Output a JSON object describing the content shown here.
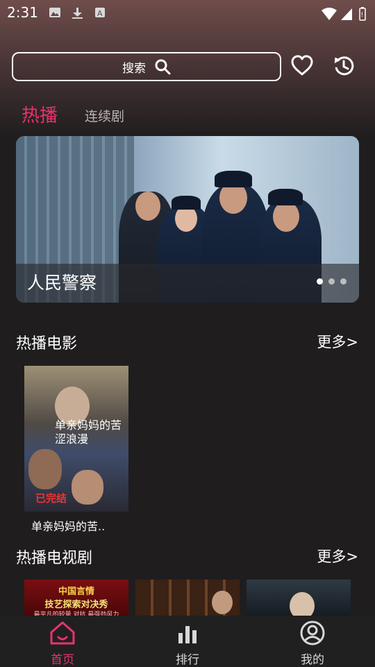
{
  "status_bar": {
    "time": "2:31"
  },
  "search": {
    "label": "搜索"
  },
  "tabs": [
    {
      "label": "热播",
      "active": true
    },
    {
      "label": "连续剧",
      "active": false
    }
  ],
  "banner": {
    "title": "人民警察",
    "dot_count": 3,
    "active_dot": 1
  },
  "movies_section": {
    "title": "热播电影",
    "more": "更多>",
    "items": [
      {
        "caption": "单亲妈妈的苦..",
        "poster_title": "单亲妈妈的苦涩浪漫",
        "poster_badge": "已完结"
      }
    ]
  },
  "tv_section": {
    "title": "热播电视剧",
    "more": "更多>",
    "thumbs": [
      {
        "line1": "中国言情",
        "line2": "技艺探索对决秀",
        "line3": "最平凡的较量  对抗  最强劲风力"
      },
      {
        "line1": "",
        "line2": "",
        "line3": ""
      },
      {
        "line1": "",
        "line2": "",
        "line3": ""
      }
    ]
  },
  "bottom_nav": [
    {
      "label": "首页",
      "icon": "home-icon",
      "active": true
    },
    {
      "label": "排行",
      "icon": "bar-chart-icon",
      "active": false
    },
    {
      "label": "我的",
      "icon": "profile-icon",
      "active": false
    }
  ],
  "colors": {
    "accent": "#e8336b",
    "nav_active": "#e8336b",
    "nav_inactive": "#d8d8d8",
    "background": "#1f1d1e"
  }
}
